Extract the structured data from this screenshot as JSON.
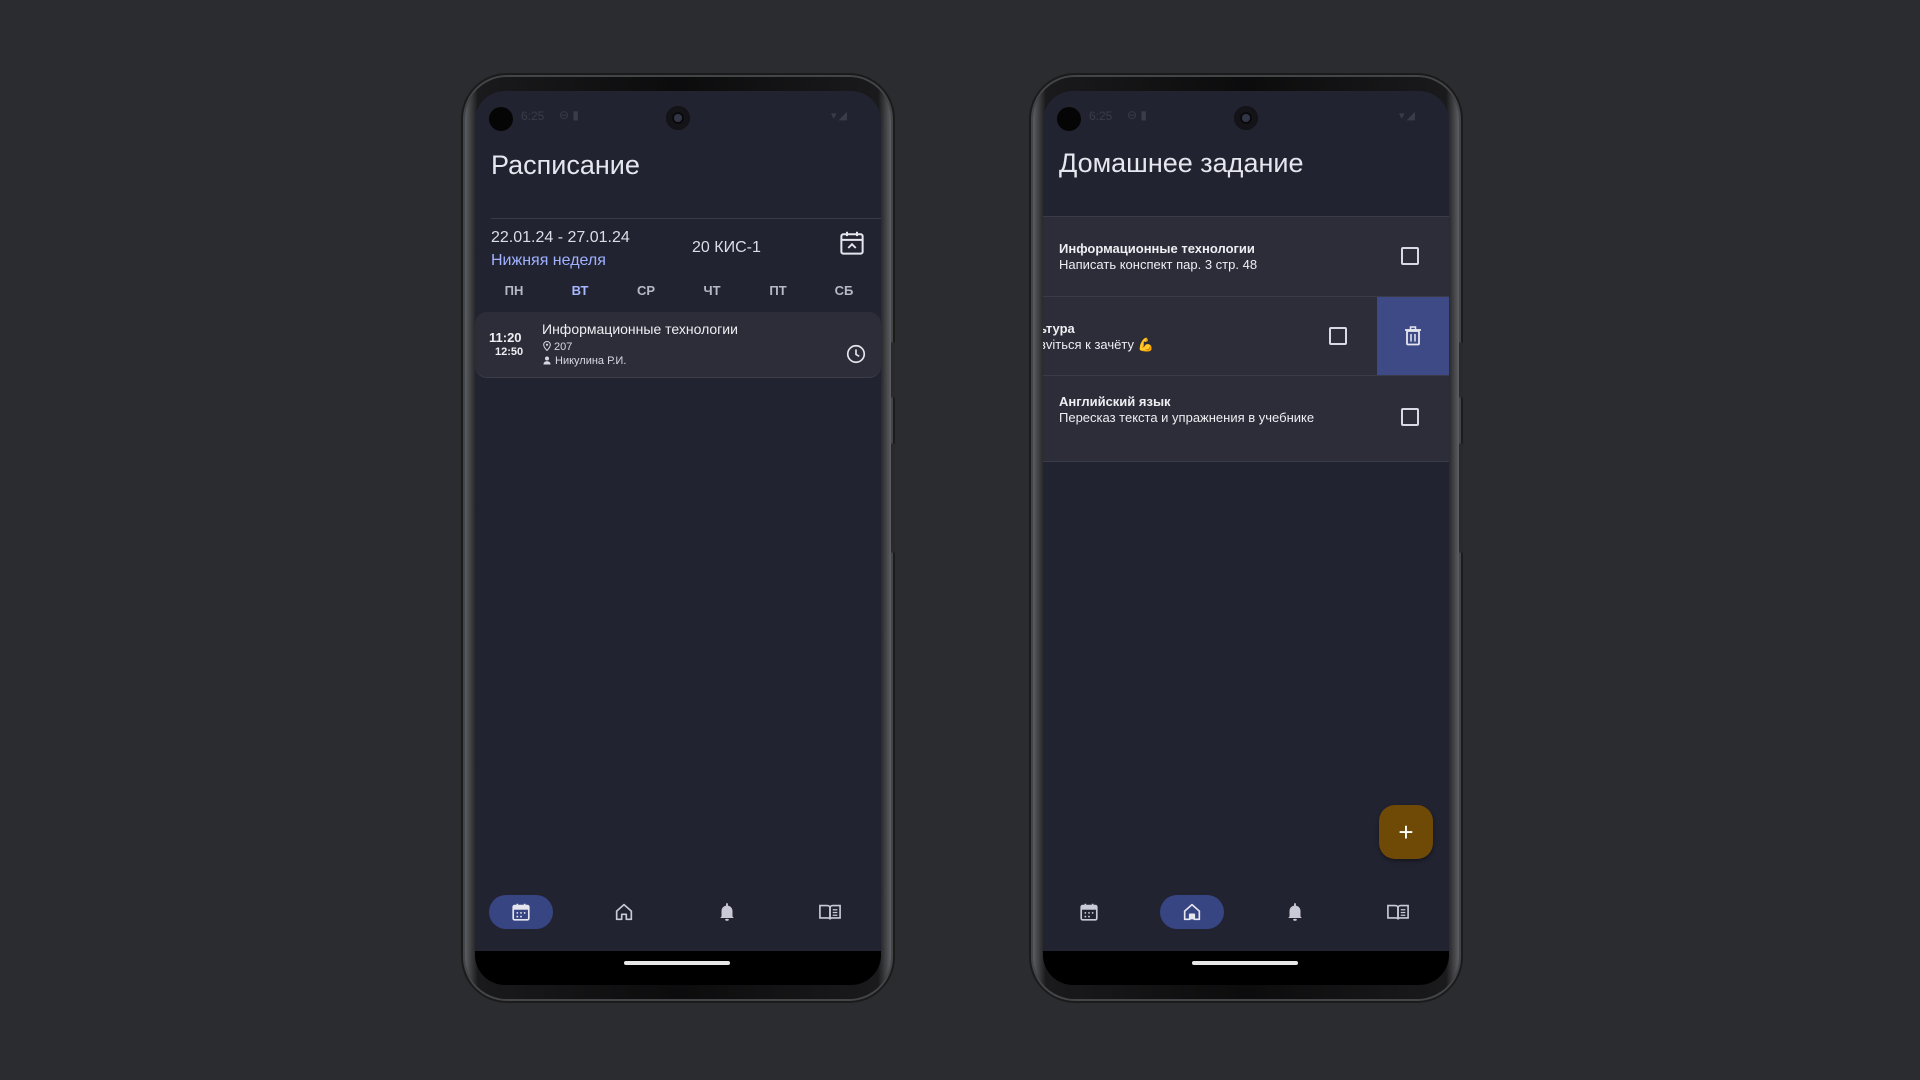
{
  "status": {
    "time": "6:25",
    "left_icons": "⊖ ▮",
    "right_icons": "▾◢"
  },
  "schedule": {
    "title": "Расписание",
    "dates": "22.01.24 - 27.01.24",
    "week_type": "Нижняя неделя",
    "group": "20 КИС-1",
    "days": [
      "ПН",
      "ВТ",
      "СР",
      "ЧТ",
      "ПТ",
      "СБ"
    ],
    "active_day": "ВТ",
    "lesson": {
      "start": "11:20",
      "end": "12:50",
      "title": "Информационные технологии",
      "room": "207",
      "teacher": "Никулина Р.И."
    }
  },
  "homework": {
    "title": "Домашнее задание",
    "items": [
      {
        "subject": "Информационные технологии",
        "task": "Написать конспект пар. 3 стр. 48",
        "checked": false
      },
      {
        "subject": "ьтура",
        "task": "вviться к зачёту 💪",
        "checked": false,
        "swiped": true
      },
      {
        "subject": "Английский язык",
        "task": "Пересказ текста и упражнения в учебнике",
        "checked": false
      }
    ],
    "fab_label": "+"
  },
  "nav": {
    "items": [
      "calendar-icon",
      "home-icon",
      "bell-icon",
      "book-icon"
    ],
    "left_active": "calendar-icon",
    "right_active": "home-icon"
  },
  "colors": {
    "background": "#2b2c30",
    "screen": "#222331",
    "accent": "#9fb1ff",
    "nav_active": "#384583",
    "fab": "#6f4a06",
    "delete": "#3d4a86"
  }
}
